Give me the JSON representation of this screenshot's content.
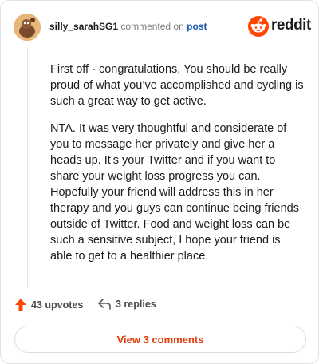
{
  "comment": {
    "username": "silly_sarahSG1",
    "commented_text": "commented on",
    "post_link": "post",
    "brand": "reddit",
    "paragraphs": [
      "First off - congratulations, You should be really proud of what you’ve accomplished and cycling is such a great way to get active.",
      "NTA. It was very thoughtful and considerate of you to message her privately and give her a heads up. It’s your Twitter and if you want to share your weight loss progress you can. Hopefully your friend will address this in her therapy and you guys can continue being friends outside of Twitter. Food and weight loss can be such a sensitive subject, I hope your friend is able to get to a healthier place."
    ]
  },
  "actions": {
    "upvotes_label": "43 upvotes",
    "replies_label": "3 replies",
    "upvote_icon": "upvote-arrow-icon",
    "reply_icon": "reply-arrow-icon"
  },
  "footer": {
    "view_comments_label": "View 3 comments"
  },
  "colors": {
    "brand_orange": "#ff4500",
    "link_blue": "#1a56b0",
    "button_text": "#e03c0a"
  }
}
